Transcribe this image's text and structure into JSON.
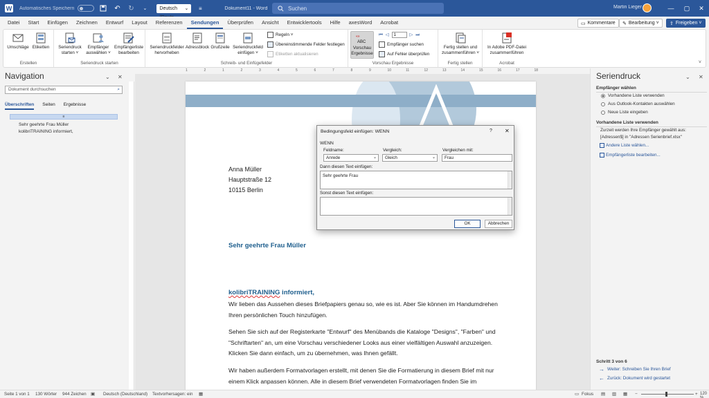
{
  "titlebar": {
    "autosave": "Automatisches Speichern",
    "language": "Deutsch (Deuts",
    "doc_title": "Dokument11 - Word",
    "search": "Suchen",
    "user": "Martin Lieger"
  },
  "menu": {
    "tabs": [
      "Datei",
      "Start",
      "Einfügen",
      "Zeichnen",
      "Entwurf",
      "Layout",
      "Referenzen",
      "Sendungen",
      "Überprüfen",
      "Ansicht",
      "Entwicklertools",
      "Hilfe",
      "axesWord",
      "Acrobat"
    ],
    "active": "Sendungen",
    "kommentare": "Kommentare",
    "bearbeitung": "Bearbeitung",
    "freigeben": "Freigeben"
  },
  "ribbon": {
    "groups": {
      "erstellen": "Erstellen",
      "start": "Seriendruck starten",
      "schreib": "Schreib- und Einfügefelder",
      "vorschau": "Vorschau Ergebnisse",
      "fertig": "Fertig stellen",
      "acrobat": "Acrobat"
    },
    "buttons": {
      "umschlaege": "Umschläge",
      "etiketten": "Etiketten",
      "seriendruck_starten": "Seriendruck starten ˅",
      "empfaenger_auswaehlen": "Empfänger auswählen ˅",
      "empfaengerliste": "Empfängerliste bearbeiten",
      "felder_hervorheben": "Seriendruckfelder hervorheben",
      "adressblock": "Adressblock",
      "grusszeile": "Grußzeile",
      "feld_einfuegen": "Seriendruckfeld einfügen ˅",
      "regeln": "Regeln ˅",
      "uebereinstimmende": "Übereinstimmende Felder festlegen",
      "etiketten_aktualisieren": "Etiketten aktualisieren",
      "vorschau": "Vorschau Ergebnisse",
      "record": "1",
      "empfaenger_suchen": "Empfänger suchen",
      "auf_fehler": "Auf Fehler überprüfen",
      "fertig_stellen": "Fertig stellen und zusammenführen ˅",
      "adobe_pdf": "In Adobe PDF-Datei zusammenführen"
    }
  },
  "nav": {
    "title": "Navigation",
    "search_placeholder": "Dokument durchsuchen",
    "tabs": [
      "Überschriften",
      "Seiten",
      "Ergebnisse"
    ],
    "headings": [
      "Sehr geehrte Frau Müller",
      "kolibriTRAINING informiert,"
    ]
  },
  "ruler": [
    "1",
    "2",
    "1",
    "2",
    "3",
    "4",
    "5",
    "6",
    "7",
    "8",
    "9",
    "10",
    "11",
    "12",
    "13",
    "14",
    "15",
    "16",
    "17",
    "18"
  ],
  "document": {
    "address": [
      "Anna Müller",
      "Hauptstraße 12",
      "10115 Berlin"
    ],
    "greeting": "Sehr geehrte Frau Müller",
    "subheading_brand": "kolibriTRAINING",
    "subheading_rest": " informiert,",
    "paragraphs": [
      "Wir lieben das Aussehen dieses Briefpapiers genau so, wie es ist. Aber Sie können im Handumdrehen Ihren persönlichen Touch hinzufügen.",
      "Sehen Sie sich auf der Registerkarte \"Entwurf\" des Menübands die Kataloge \"Designs\", \"Farben\" und \"Schriftarten\" an, um eine Vorschau verschiedener Looks aus einer vielfältigen Auswahl anzuzeigen. Klicken Sie dann einfach, um zu übernehmen, was Ihnen gefällt.",
      "Wir haben außerdem Formatvorlagen erstellt, mit denen Sie die Formatierung in diesem Brief mit nur einem Klick anpassen können. Alle in diesem Brief verwendeten Formatvorlagen finden Sie im Menüband auf der Registerkarte \"Start\" im Katalog"
    ]
  },
  "dialog": {
    "title": "Bedingungsfeld einfügen: WENN",
    "help": "?",
    "section": "WENN",
    "feldname_label": "Feldname:",
    "feldname_value": "Anrede",
    "vergleich_label": "Vergleich:",
    "vergleich_value": "Gleich",
    "vergleichen_label": "Vergleichen mit:",
    "vergleichen_value": "Frau",
    "dann_label": "Dann diesen Text einfügen:",
    "dann_value": "Sehr geehrte Frau",
    "sonst_label": "Sonst diesen Text einfügen:",
    "sonst_value": "",
    "ok": "OK",
    "cancel": "Abbrechen"
  },
  "mailmerge": {
    "title": "Seriendruck",
    "empfaenger_waehlen": "Empfänger wählen",
    "options": [
      "Vorhandene Liste verwenden",
      "Aus Outlook-Kontakten auswählen",
      "Neue Liste eingeben"
    ],
    "selected_option": 0,
    "vorhandene_section": "Vorhandene Liste verwenden",
    "info_line1": "Zurzeit werden Ihre Empfänger gewählt aus:",
    "info_line2": "[Adressen$] in \"Adressen Serienbrief.xlsx\"",
    "link_andere": "Andere Liste wählen...",
    "link_bearbeiten": "Empfängerliste bearbeiten...",
    "step": "Schritt 3 von 6",
    "next": "Weiter: Schreiben Sie Ihren Brief",
    "back": "Zurück: Dokument wird gestartet"
  },
  "statusbar": {
    "page": "Seite 1 von 1",
    "words": "130 Wörter",
    "chars": "944 Zeichen",
    "language": "Deutsch (Deutschland)",
    "prediction": "Textvorhersagen: ein",
    "focus": "Fokus",
    "zoom": "120 %"
  },
  "colors": {
    "accent": "#2b579a",
    "heading": "#1f5f8e",
    "header_band": "#8eaec8"
  }
}
